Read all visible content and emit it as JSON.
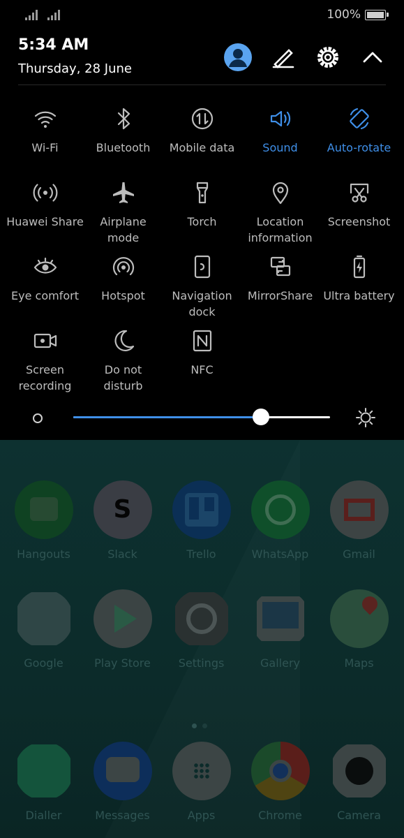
{
  "status_bar": {
    "battery_percent": "100%",
    "battery_level": 1.0
  },
  "header": {
    "time": "5:34 AM",
    "date": "Thursday, 28 June"
  },
  "tiles": [
    {
      "label": "Wi-Fi",
      "icon": "wifi-icon",
      "active": false
    },
    {
      "label": "Bluetooth",
      "icon": "bluetooth-icon",
      "active": false
    },
    {
      "label": "Mobile data",
      "icon": "mobile-data-icon",
      "active": false
    },
    {
      "label": "Sound",
      "icon": "sound-icon",
      "active": true
    },
    {
      "label": "Auto-rotate",
      "icon": "auto-rotate-icon",
      "active": true
    },
    {
      "label": "Huawei Share",
      "icon": "huawei-share-icon",
      "active": false
    },
    {
      "label": "Airplane mode",
      "icon": "airplane-icon",
      "active": false
    },
    {
      "label": "Torch",
      "icon": "torch-icon",
      "active": false
    },
    {
      "label": "Location information",
      "icon": "location-icon",
      "active": false
    },
    {
      "label": "Screenshot",
      "icon": "screenshot-icon",
      "active": false
    },
    {
      "label": "Eye comfort",
      "icon": "eye-icon",
      "active": false
    },
    {
      "label": "Hotspot",
      "icon": "hotspot-icon",
      "active": false
    },
    {
      "label": "Navigation dock",
      "icon": "navigation-dock-icon",
      "active": false
    },
    {
      "label": "MirrorShare",
      "icon": "mirrorshare-icon",
      "active": false
    },
    {
      "label": "Ultra battery",
      "icon": "ultra-battery-icon",
      "active": false
    },
    {
      "label": "Screen recording",
      "icon": "screen-recording-icon",
      "active": false
    },
    {
      "label": "Do not disturb",
      "icon": "moon-icon",
      "active": false
    },
    {
      "label": "NFC",
      "icon": "nfc-icon",
      "active": false
    }
  ],
  "brightness": {
    "level": 0.73
  },
  "home": {
    "row1": [
      "Hangouts",
      "Slack",
      "Trello",
      "WhatsApp",
      "Gmail"
    ],
    "row2": [
      "Google",
      "Play Store",
      "Settings",
      "Gallery",
      "Maps"
    ],
    "dock": [
      "Dialler",
      "Messages",
      "Apps",
      "Chrome",
      "Camera"
    ]
  },
  "colors": {
    "accent": "#3f8fe8",
    "panel_bg": "#000000",
    "tile_text": "#bdbdbd"
  }
}
